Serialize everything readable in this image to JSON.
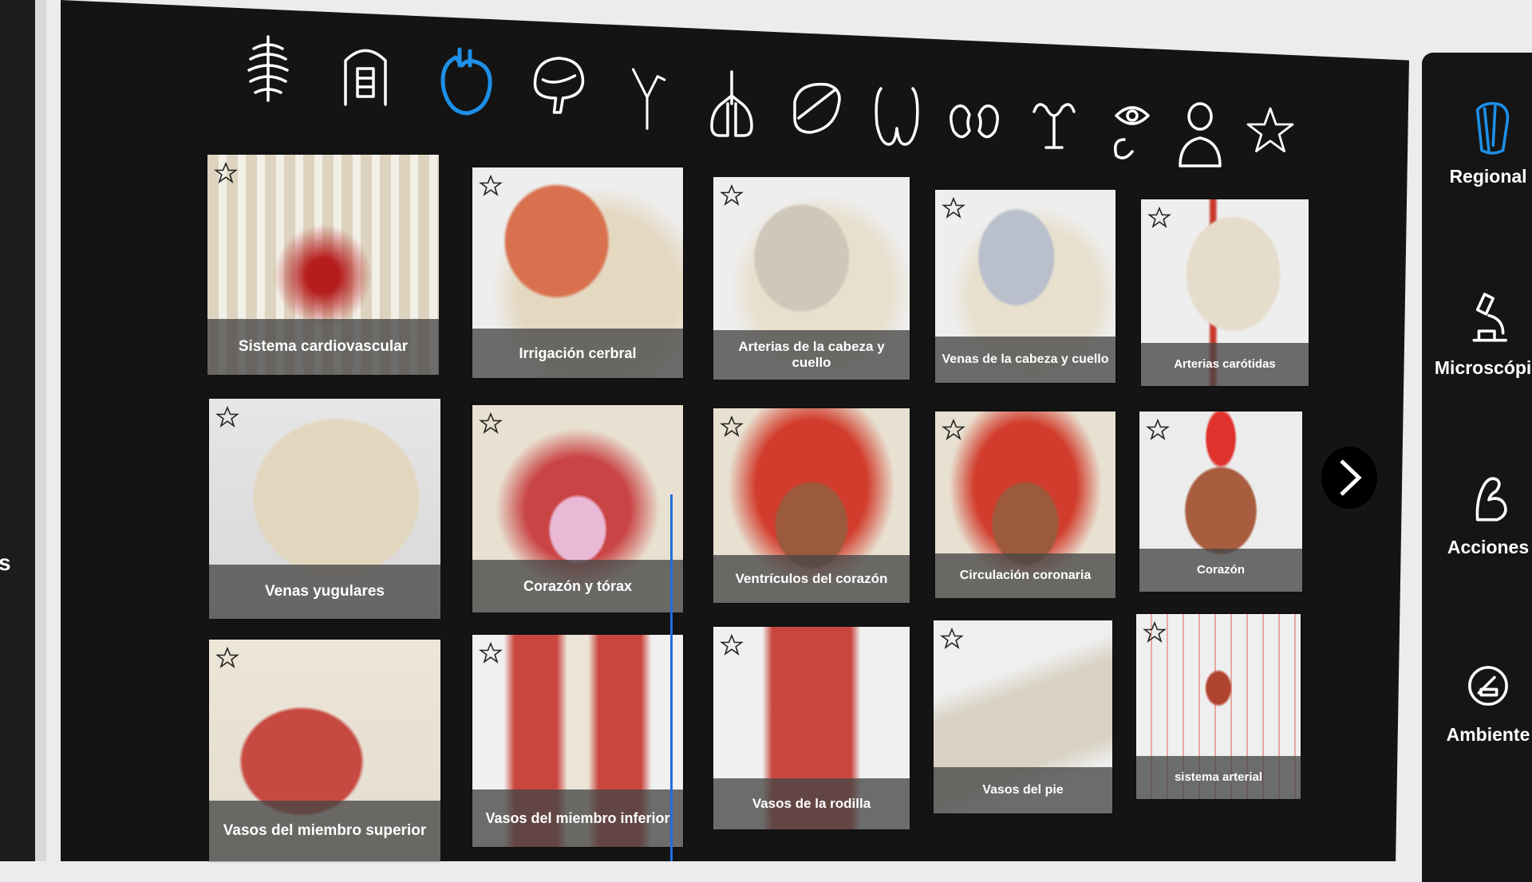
{
  "left_edge_text": "s",
  "categories": [
    {
      "icon": "skeleton-icon",
      "selected": false
    },
    {
      "icon": "muscles-icon",
      "selected": false
    },
    {
      "icon": "heart-icon",
      "selected": true
    },
    {
      "icon": "brain-icon",
      "selected": false
    },
    {
      "icon": "nerve-icon",
      "selected": false
    },
    {
      "icon": "lungs-icon",
      "selected": false
    },
    {
      "icon": "stomach-icon",
      "selected": false
    },
    {
      "icon": "thyroid-icon",
      "selected": false
    },
    {
      "icon": "kidneys-icon",
      "selected": false
    },
    {
      "icon": "reproductive-icon",
      "selected": false
    },
    {
      "icon": "eye-ear-icon",
      "selected": false
    },
    {
      "icon": "person-icon",
      "selected": false
    },
    {
      "icon": "favorites-star-icon",
      "selected": false
    }
  ],
  "tiles": [
    {
      "label": "Sistema cardiovascular"
    },
    {
      "label": "Irrigación cerbral"
    },
    {
      "label": "Arterias de la cabeza y cuello"
    },
    {
      "label": "Venas de la cabeza y cuello"
    },
    {
      "label": "Arterias carótidas"
    },
    {
      "label": "Venas yugulares"
    },
    {
      "label": "Corazón y tórax"
    },
    {
      "label": "Ventrículos del corazón"
    },
    {
      "label": "Circulación coronaria"
    },
    {
      "label": "Corazón"
    },
    {
      "label": "Vasos del miembro superior"
    },
    {
      "label": "Vasos del miembro inferior"
    },
    {
      "label": "Vasos de la rodilla"
    },
    {
      "label": "Vasos del pie"
    },
    {
      "label": "sistema arterial"
    }
  ],
  "side_menu": [
    {
      "label": "Regional",
      "icon": "regional-shoulder-icon"
    },
    {
      "label": "Microscópic",
      "icon": "microscope-icon"
    },
    {
      "label": "Acciones",
      "icon": "arm-flex-icon"
    },
    {
      "label": "Ambiente",
      "icon": "environment-icon"
    }
  ],
  "colors": {
    "selected": "#1e90e8",
    "icon": "#ffffff",
    "panel": "#141414",
    "caption_bg": "#464646"
  }
}
